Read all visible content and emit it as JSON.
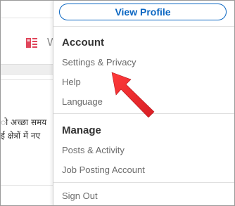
{
  "background": {
    "tab_letter": "W",
    "text_line_1": "ो अच्छा समय",
    "text_line_2": "ई क्षेत्रों में नए"
  },
  "menu": {
    "view_profile_label": "View Profile",
    "account": {
      "title": "Account",
      "items": [
        "Settings & Privacy",
        "Help",
        "Language"
      ]
    },
    "manage": {
      "title": "Manage",
      "items": [
        "Posts & Activity",
        "Job Posting Account"
      ]
    },
    "sign_out_label": "Sign Out"
  },
  "colors": {
    "accent": "#0a66c2",
    "annotation_arrow": "#e8232a",
    "background_icon": "#e0455a"
  },
  "icons": {
    "background_tab_icon": "article-icon"
  }
}
